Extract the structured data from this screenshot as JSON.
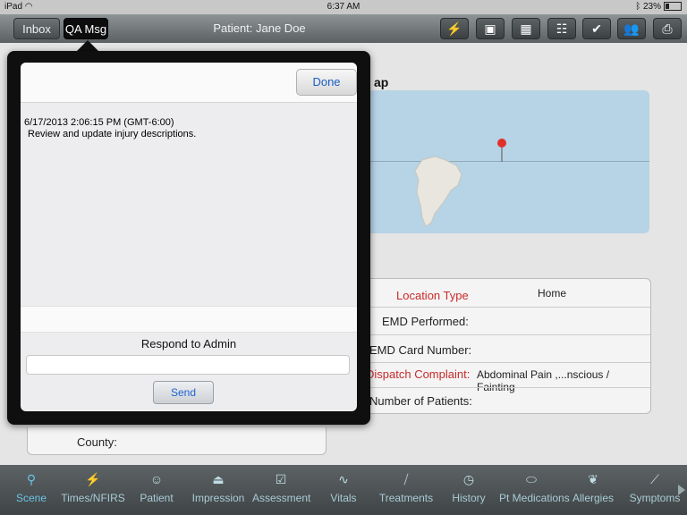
{
  "status_bar": {
    "device": "iPad",
    "time": "6:37 AM",
    "battery": "23%"
  },
  "nav": {
    "inbox_label": "Inbox",
    "qa_label": "QA Msg",
    "title": "Patient: Jane Doe"
  },
  "toolbar_icons": [
    "lightning-icon",
    "camera-icon",
    "gallery-icon",
    "clipboard-icon",
    "check-icon",
    "people-icon",
    "printer-icon"
  ],
  "background": {
    "map_heading_fragment": "ap",
    "rows": [
      {
        "label": "Location Type",
        "value": "Home"
      },
      {
        "label": "EMD Performed:",
        "value": ""
      },
      {
        "label": "EMD Card Number:",
        "value": ""
      },
      {
        "label": "Dispatch Complaint:",
        "value": "Abdominal Pain ,...nscious / Fainting"
      },
      {
        "label": "Number of Patients:",
        "value": ""
      }
    ],
    "county_label": "County:"
  },
  "popover": {
    "done_label": "Done",
    "message_timestamp": "6/17/2013 2:06:15 PM (GMT-6:00)",
    "message_text": "Review and update injury descriptions.",
    "respond_title": "Respond to Admin",
    "response_value": "",
    "send_label": "Send"
  },
  "tabs": [
    {
      "label": "Scene",
      "icon": "location-pin-icon"
    },
    {
      "label": "Times/NFIRS",
      "icon": "runner-icon"
    },
    {
      "label": "Patient",
      "icon": "patient-icon"
    },
    {
      "label": "Impression",
      "icon": "siren-icon"
    },
    {
      "label": "Assessment",
      "icon": "check-square-icon"
    },
    {
      "label": "Vitals",
      "icon": "heartbeat-icon"
    },
    {
      "label": "Treatments",
      "icon": "bandage-icon"
    },
    {
      "label": "History",
      "icon": "clock-icon"
    },
    {
      "label": "Pt Medications",
      "icon": "pill-icon"
    },
    {
      "label": "Allergies",
      "icon": "allergy-icon"
    },
    {
      "label": "Symptoms",
      "icon": "thermometer-icon"
    }
  ],
  "colors": {
    "accent": "#1b5ec4",
    "tab_active": "#6bc3e6",
    "required_label": "#c92a2a"
  }
}
